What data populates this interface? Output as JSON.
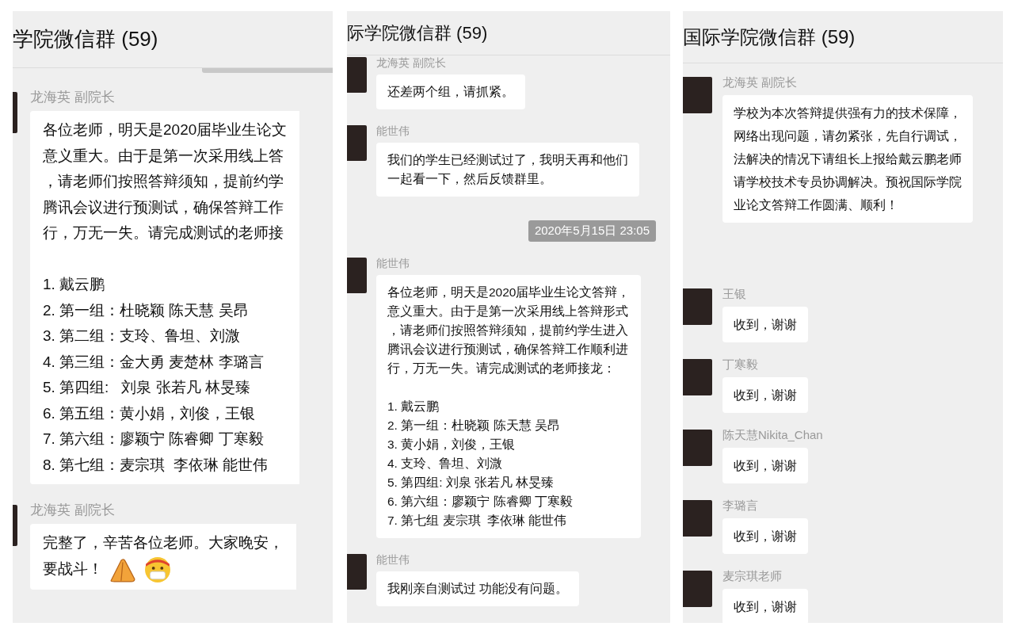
{
  "panels": [
    {
      "title": "学院微信群 (59)",
      "items": [
        {
          "kind": "message",
          "sender": "龙海英 副院长",
          "paragraphs": [
            {
              "lines": [
                "各位老师，明天是2020届毕业生论文",
                "意义重大。由于是第一次采用线上答",
                "，请老师们按照答辩须知，提前约学",
                "腾讯会议进行预测试，确保答辩工作",
                "行，万无一失。请完成测试的老师接"
              ]
            },
            {
              "lines": [
                "1. 戴云鹏",
                "2. 第一组：杜晓颖 陈天慧 吴昂",
                "3. 第二组：支玲、鲁坦、刘溦",
                "4. 第三组：金大勇 麦楚林 李璐言",
                "5. 第四组:   刘泉 张若凡 林旻臻",
                "6. 第五组：黄小娟，刘俊，王银",
                "7. 第六组：廖颖宁 陈睿卿 丁寒毅",
                "8. 第七组：麦宗琪  李依琳 能世伟"
              ]
            }
          ]
        },
        {
          "kind": "message_with_emoji",
          "sender": "龙海英 副院长",
          "paragraphs": [
            {
              "lines": [
                "完整了，辛苦各位老师。大家晚安，",
                "要战斗！"
              ]
            }
          ]
        }
      ]
    },
    {
      "title": "际学院微信群 (59)",
      "items": [
        {
          "kind": "message",
          "sender": "龙海英 副院长",
          "paragraphs": [
            {
              "lines": [
                "还差两个组，请抓紧。"
              ]
            }
          ]
        },
        {
          "kind": "message",
          "sender": "能世伟",
          "paragraphs": [
            {
              "lines": [
                "我们的学生已经测试过了，我明天再和他们",
                "一起看一下，然后反馈群里。"
              ]
            }
          ]
        },
        {
          "kind": "timestamp",
          "text": "2020年5月15日 23:05"
        },
        {
          "kind": "message",
          "sender": "能世伟",
          "paragraphs": [
            {
              "lines": [
                "各位老师，明天是2020届毕业生论文答辩，",
                "意义重大。由于是第一次采用线上答辩形式",
                "，请老师们按照答辩须知，提前约学生进入",
                "腾讯会议进行预测试，确保答辩工作顺利进",
                "行，万无一失。请完成测试的老师接龙："
              ]
            },
            {
              "lines": [
                "1. 戴云鹏",
                "2. 第一组：杜晓颖 陈天慧 吴昂",
                "3. 黄小娟，刘俊，王银",
                "4. 支玲、鲁坦、刘溦",
                "5. 第四组: 刘泉 张若凡 林旻臻",
                "6. 第六组：廖颖宁 陈睿卿 丁寒毅",
                "7. 第七组 麦宗琪  李依琳 能世伟"
              ]
            }
          ]
        },
        {
          "kind": "message",
          "sender": "能世伟",
          "paragraphs": [
            {
              "lines": [
                "我刚亲自测试过 功能没有问题。"
              ]
            }
          ]
        }
      ]
    },
    {
      "title": "国际学院微信群 (59)",
      "items": [
        {
          "kind": "message",
          "sender": "龙海英 副院长",
          "paragraphs": [
            {
              "lines": [
                "学校为本次答辩提供强有力的技术保障，",
                "网络出现问题，请勿紧张，先自行调试，",
                "法解决的情况下请组长上报给戴云鹏老师",
                "请学校技术专员协调解决。预祝国际学院",
                "业论文答辩工作圆满、顺利！"
              ]
            }
          ]
        },
        {
          "kind": "message",
          "sender": "王银",
          "paragraphs": [
            {
              "lines": [
                "收到，谢谢"
              ]
            }
          ]
        },
        {
          "kind": "message",
          "sender": "丁寒毅",
          "paragraphs": [
            {
              "lines": [
                "收到，谢谢"
              ]
            }
          ]
        },
        {
          "kind": "message",
          "sender": "陈天慧Nikita_Chan",
          "paragraphs": [
            {
              "lines": [
                "收到，谢谢"
              ]
            }
          ]
        },
        {
          "kind": "message",
          "sender": "李璐言",
          "paragraphs": [
            {
              "lines": [
                "收到，谢谢"
              ]
            }
          ]
        },
        {
          "kind": "message",
          "sender": "麦宗琪老师",
          "paragraphs": [
            {
              "lines": [
                "收到，谢谢"
              ]
            }
          ]
        }
      ]
    }
  ]
}
